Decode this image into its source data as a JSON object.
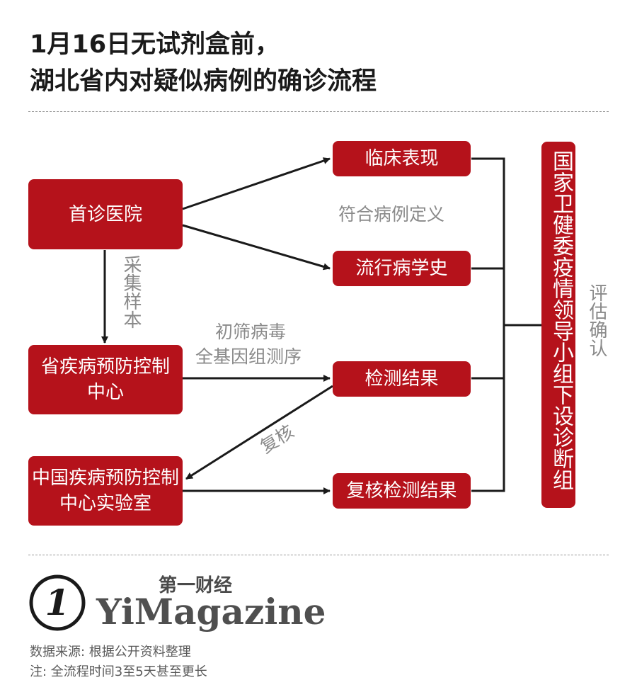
{
  "title": {
    "line1": "1月16日无试剂盒前，",
    "line2": "湖北省内对疑似病例的确诊流程"
  },
  "boxes": {
    "first_hospital": "首诊医院",
    "clinical": "临床表现",
    "epi_history": "流行病学史",
    "provincial_cdc": "省疾病预防控制中心",
    "test_result": "检测结果",
    "china_cdc_lab": "中国疾病预防控制中心实验室",
    "recheck_result": "复核检测结果",
    "nhc_group": "国家卫健委疫情领导小组下设诊断组"
  },
  "labels": {
    "collect_sample": "采集样本",
    "meets_definition": "符合病例定义",
    "screening_line1": "初筛病毒",
    "screening_line2": "全基因组测序",
    "recheck": "复核",
    "evaluate": "评估确认"
  },
  "branding": {
    "logo_numeral": "1",
    "name_cn": "第一财经",
    "name_en": "YiMagazine"
  },
  "footnotes": {
    "source": "数据来源: 根据公开资料整理",
    "note": "注: 全流程时间3至5天甚至更长"
  },
  "colors": {
    "box_red": "#b5121b",
    "line_dark": "#1a1a1a",
    "label_gray": "#8a8a8a"
  }
}
